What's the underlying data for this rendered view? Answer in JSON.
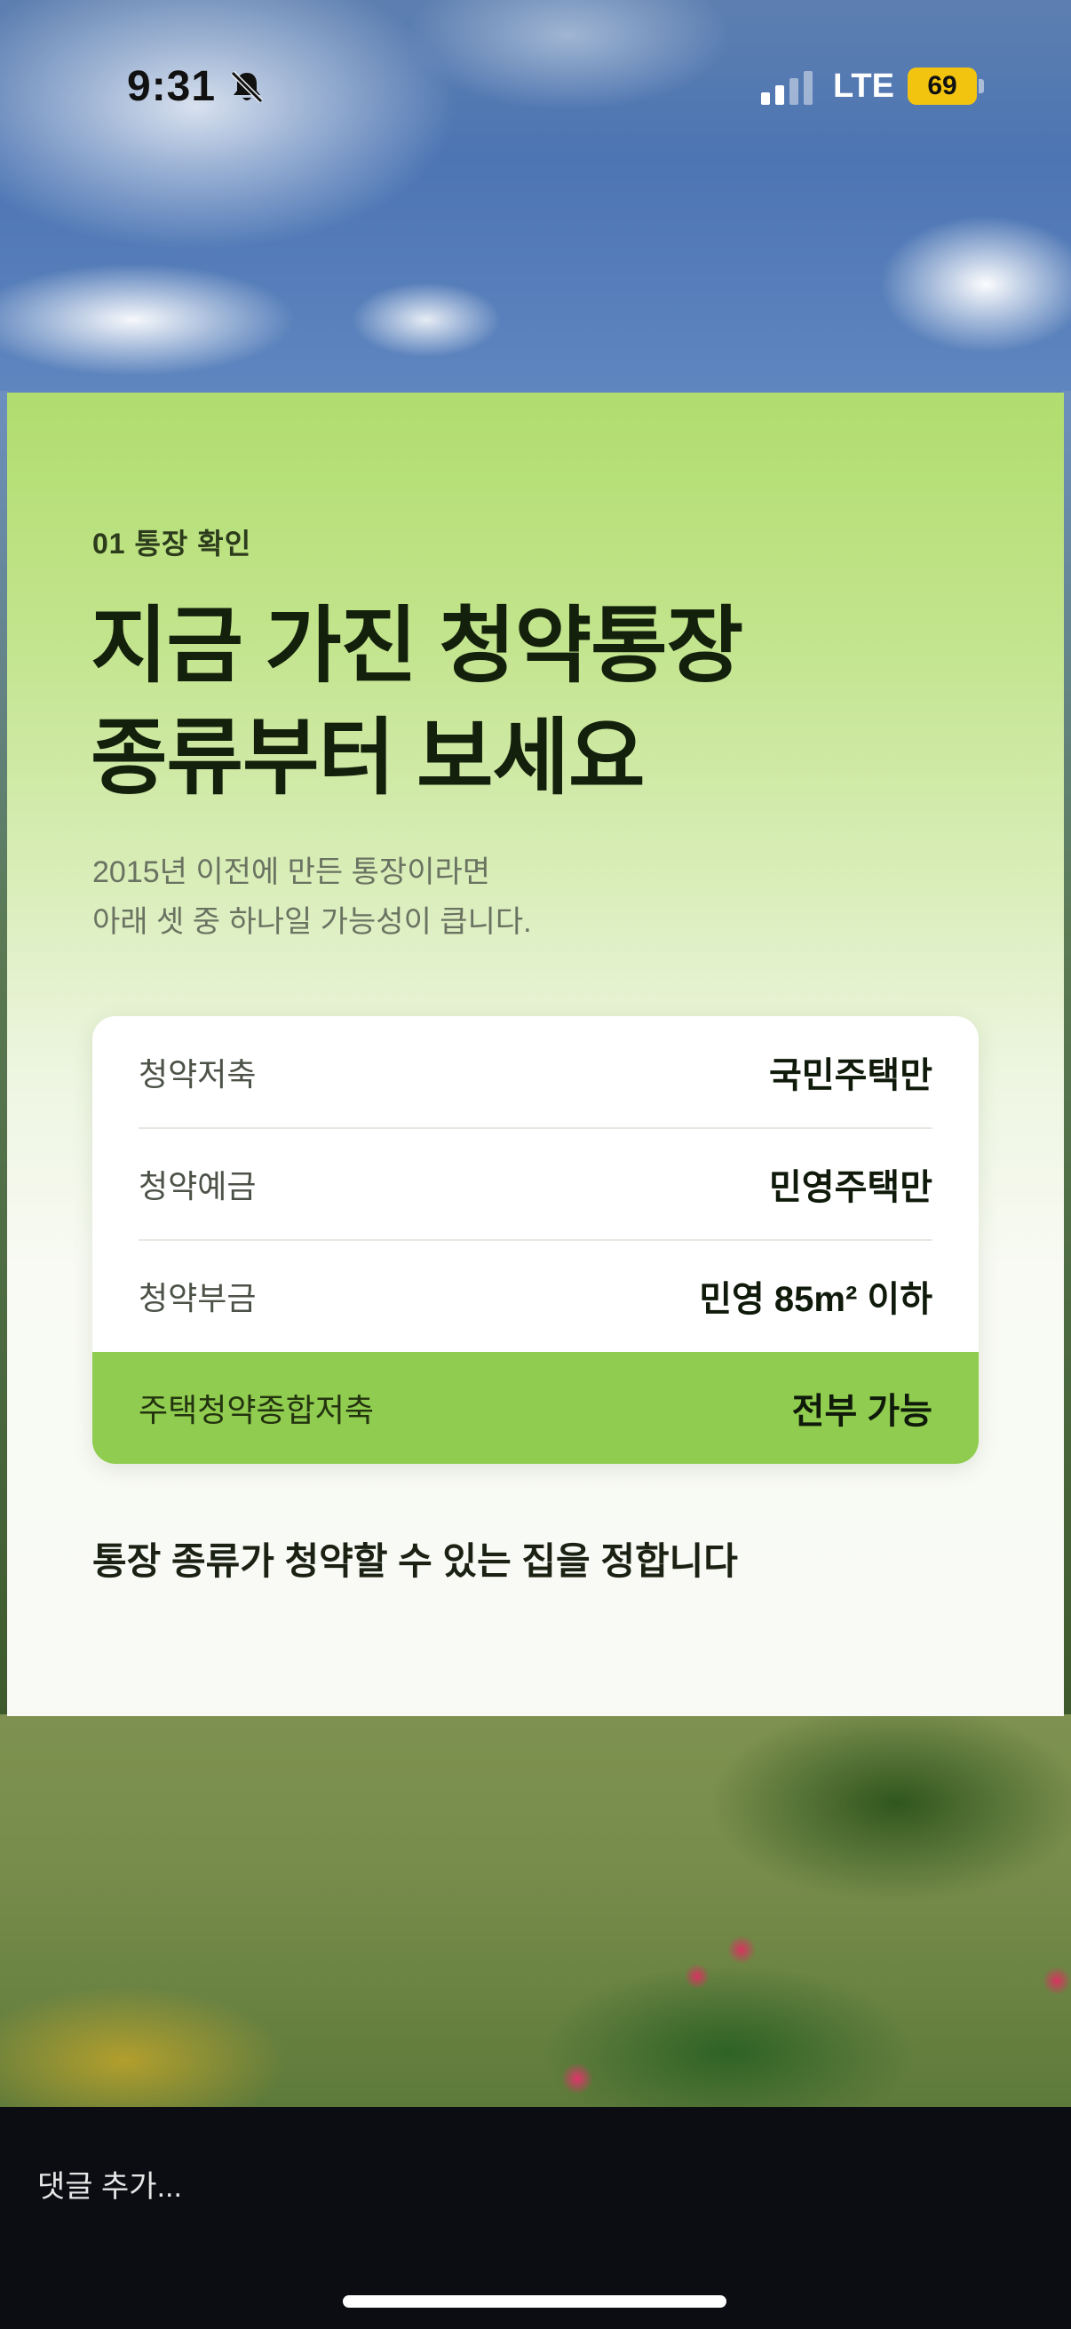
{
  "status_bar": {
    "time": "9:31",
    "network": "LTE",
    "battery": "69",
    "bell_icon": "bell-slash-icon",
    "battery_color": "#f2c410"
  },
  "card": {
    "step_label": "01  통장 확인",
    "headline_line1": "지금 가진 청약통장",
    "headline_line2": "종류부터 보세요",
    "subtext_line1": "2015년 이전에 만든 통장이라면",
    "subtext_line2": "아래 셋 중 하나일 가능성이 큽니다.",
    "rows": [
      {
        "name": "청약저축",
        "value": "국민주택만"
      },
      {
        "name": "청약예금",
        "value": "민영주택만"
      },
      {
        "name": "청약부금",
        "value": "민영 85m² 이하"
      },
      {
        "name": "주택청약종합저축",
        "value": "전부 가능"
      }
    ],
    "highlight_color": "#8fcc4f",
    "summary": "통장 종류가 청약할 수 있는 집을 정합니다"
  },
  "comment_bar": {
    "placeholder": "댓글 추가..."
  }
}
